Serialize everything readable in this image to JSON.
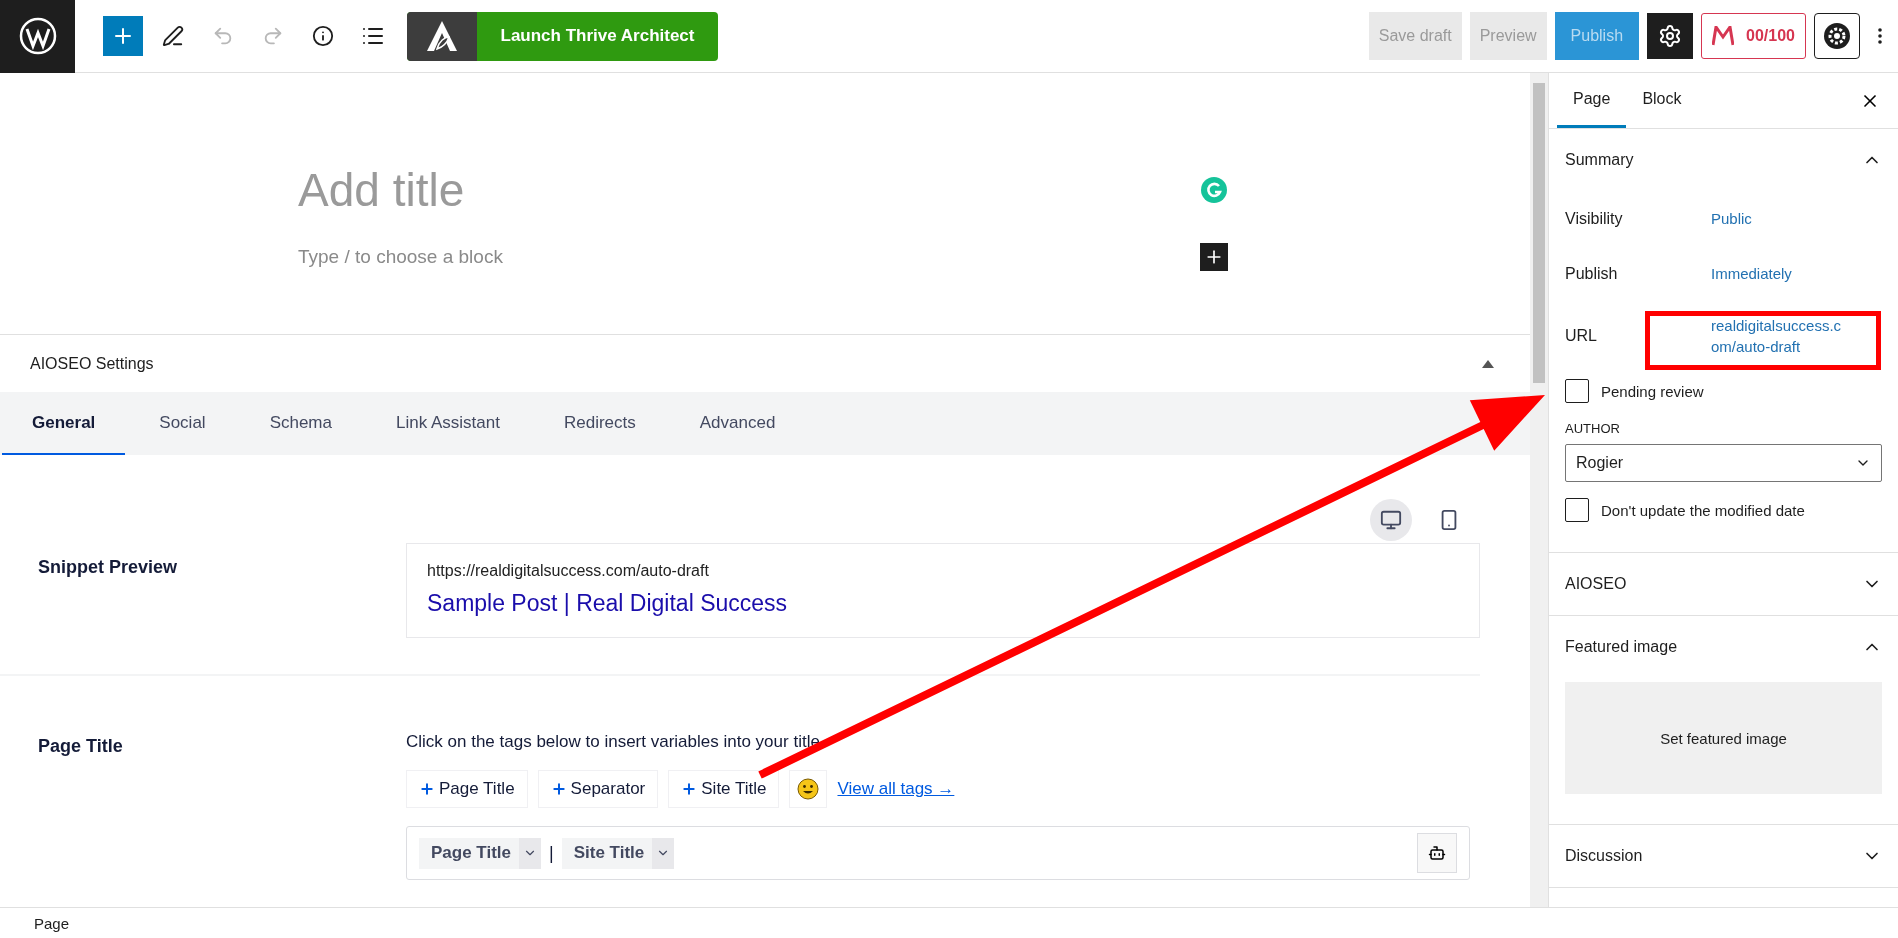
{
  "toolbar": {
    "tools": [
      {
        "kind": "add",
        "disabled": false
      },
      {
        "kind": "pen",
        "disabled": false
      },
      {
        "kind": "undo",
        "disabled": true
      },
      {
        "kind": "redo",
        "disabled": true
      },
      {
        "kind": "info",
        "disabled": false
      },
      {
        "kind": "list",
        "disabled": false
      }
    ],
    "launch_button": "Launch Thrive Architect",
    "save_draft": "Save draft",
    "preview": "Preview",
    "publish": "Publish",
    "settings_selected": true,
    "seo_score": "00/100"
  },
  "editor": {
    "title_placeholder": "Add title",
    "block_placeholder": "Type / to choose a block"
  },
  "aioseo": {
    "title": "AIOSEO Settings",
    "expanded": true,
    "tabs": [
      {
        "label": "General",
        "selected": true
      },
      {
        "label": "Social",
        "selected": false
      },
      {
        "label": "Schema",
        "selected": false
      },
      {
        "label": "Link Assistant",
        "selected": false
      },
      {
        "label": "Redirects",
        "selected": false
      },
      {
        "label": "Advanced",
        "selected": false
      }
    ],
    "devices": [
      {
        "kind": "desktop",
        "selected": true
      },
      {
        "kind": "mobile",
        "selected": false
      }
    ],
    "snippet_label": "Snippet Preview",
    "snippet_url": "https://realdigitalsuccess.com/auto-draft",
    "snippet_title": "Sample Post | Real Digital Success",
    "page_title_label": "Page Title",
    "hint": "Click on the tags below to insert variables into your title",
    "tags": [
      "Page Title",
      "Separator",
      "Site Title"
    ],
    "view_all": "View all tags →",
    "tokens": [
      "Page Title",
      "Site Title"
    ],
    "token_separator": "|"
  },
  "sidebar": {
    "tabs": [
      {
        "label": "Page",
        "selected": true
      },
      {
        "label": "Block",
        "selected": false
      }
    ],
    "summary": {
      "title": "Summary",
      "expanded": true,
      "rows": [
        {
          "label": "Visibility",
          "value": "Public"
        },
        {
          "label": "Publish",
          "value": "Immediately"
        },
        {
          "label": "URL",
          "value": "realdigitalsuccess.com/auto-draft"
        }
      ],
      "pending_review": {
        "label": "Pending review",
        "checked": false
      },
      "author_label": "AUTHOR",
      "author": "Rogier",
      "dont_update": {
        "label": "Don't update the modified date",
        "checked": false
      }
    },
    "panels": [
      {
        "title": "AIOSEO",
        "expanded": false
      },
      {
        "title": "Featured image",
        "expanded": true,
        "button": "Set featured image"
      },
      {
        "title": "Discussion",
        "expanded": false
      }
    ]
  },
  "status_bar": "Page"
}
